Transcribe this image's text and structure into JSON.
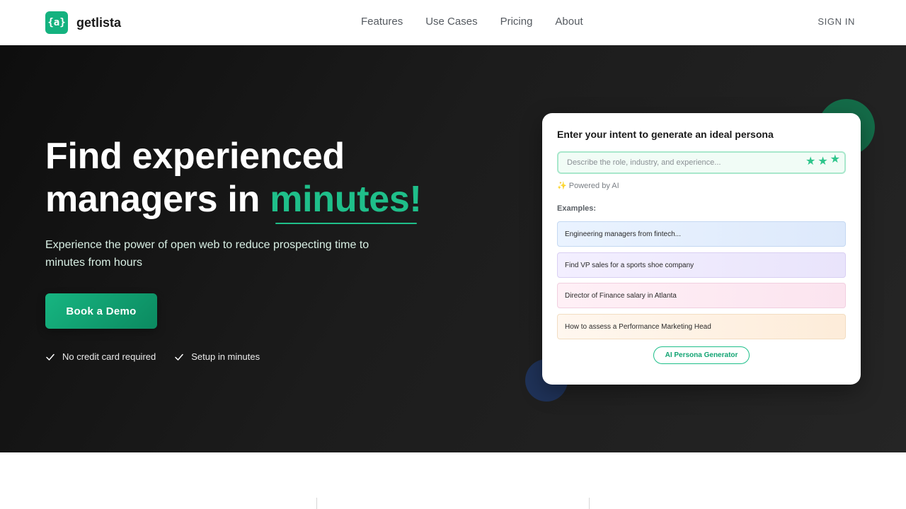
{
  "header": {
    "logo_mark": "{a}",
    "logo_text": "getlista",
    "nav": [
      "Features",
      "Use Cases",
      "Pricing",
      "About"
    ],
    "sign_in": "SIGN IN"
  },
  "hero": {
    "title_line1": "Find experienced",
    "title_line2_prefix": "managers in ",
    "title_accent": "minutes!",
    "subtitle": "Experience the power of open web to reduce prospecting time to minutes from hours",
    "cta_label": "Book a Demo",
    "perks": [
      "No credit card required",
      "Setup in minutes"
    ]
  },
  "card": {
    "title": "Enter your intent to generate an ideal persona",
    "input_placeholder": "Describe the role, industry, and experience...",
    "input_value": "",
    "powered_by": "✨ Powered by AI",
    "examples_label": "Examples:",
    "examples": [
      "Engineering managers from fintech...",
      "Find VP sales for a sports shoe company",
      "Director of Finance salary in Atlanta",
      "How to assess a Performance Marketing Head"
    ],
    "generator_button": "AI Persona Generator"
  },
  "colors": {
    "accent": "#1fbf8a",
    "brand": "#14b27f",
    "hero_bg": "#161616"
  }
}
